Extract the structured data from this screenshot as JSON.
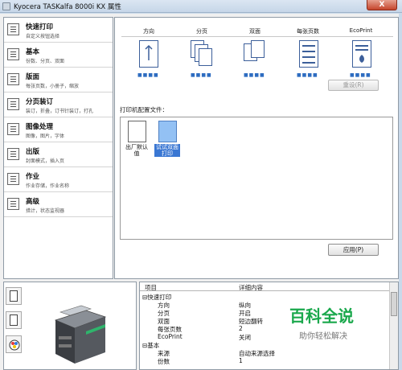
{
  "window": {
    "title": "Kyocera TASKalfa 8000i KX 属性",
    "close_label": "X"
  },
  "nav": [
    {
      "label": "快速打印",
      "sub": "自定义按钮选择",
      "icon": "quick-print-icon"
    },
    {
      "label": "基本",
      "sub": "份数、分页、双面",
      "icon": "basic-icon"
    },
    {
      "label": "版面",
      "sub": "每张页数，小册子，缩放",
      "icon": "layout-icon"
    },
    {
      "label": "分页装订",
      "sub": "装订，折叠，订书针装订，打孔",
      "icon": "finishing-icon"
    },
    {
      "label": "图像处理",
      "sub": "图像，图片，字体",
      "icon": "imaging-icon"
    },
    {
      "label": "出版",
      "sub": "封面模式，插入页",
      "icon": "publishing-icon"
    },
    {
      "label": "作业",
      "sub": "作业存储，作业名称",
      "icon": "job-icon"
    },
    {
      "label": "高级",
      "sub": "措计，状态监视器",
      "icon": "advanced-icon"
    }
  ],
  "quick_print": {
    "columns": [
      "方向",
      "分页",
      "双面",
      "每张页数",
      "EcoPrint"
    ],
    "reset_label": "重设(R)"
  },
  "profiles": {
    "label": "打印机配置文件：",
    "items": [
      {
        "caption": "出厂默认值",
        "selected": false
      },
      {
        "caption": "试试双面打印",
        "selected": true
      }
    ],
    "apply_label": "应用(P)"
  },
  "details": {
    "headers": [
      "项目",
      "详细内容"
    ],
    "rows": [
      {
        "item": "快速打印",
        "value": "",
        "level": 0,
        "group": true
      },
      {
        "item": "方向",
        "value": "纵向",
        "level": 1
      },
      {
        "item": "分页",
        "value": "开启",
        "level": 1
      },
      {
        "item": "双面",
        "value": "短边翻转",
        "level": 1
      },
      {
        "item": "每张页数",
        "value": "2",
        "level": 1
      },
      {
        "item": "EcoPrint",
        "value": "关闭",
        "level": 1
      },
      {
        "item": "基本",
        "value": "",
        "level": 0,
        "group": true
      },
      {
        "item": "来源",
        "value": "自动来源选择",
        "level": 1
      },
      {
        "item": "份数",
        "value": "1",
        "level": 1
      }
    ]
  },
  "watermark": {
    "line1": "百科全说",
    "line2": "助你轻松解决"
  },
  "colors": {
    "accent": "#3a77d3",
    "watermark": "#1aa84c"
  }
}
